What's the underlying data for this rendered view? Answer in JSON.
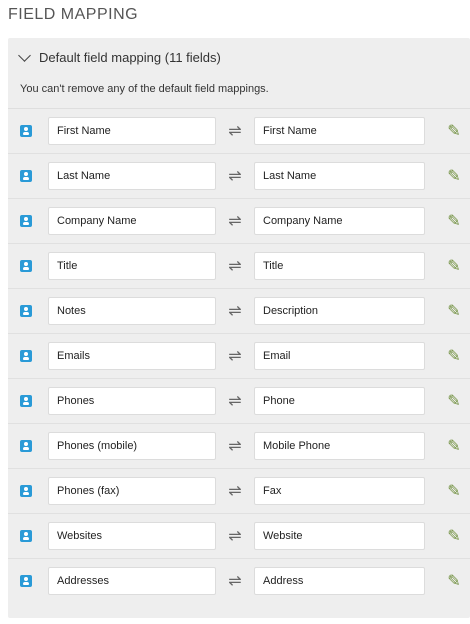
{
  "title": "FIELD MAPPING",
  "section": {
    "label": "Default field mapping (11 fields)",
    "note": "You can't remove any of the default field mappings."
  },
  "mappings": [
    {
      "left": "First Name",
      "right": "First Name"
    },
    {
      "left": "Last Name",
      "right": "Last Name"
    },
    {
      "left": "Company Name",
      "right": "Company Name"
    },
    {
      "left": "Title",
      "right": "Title"
    },
    {
      "left": "Notes",
      "right": "Description"
    },
    {
      "left": "Emails",
      "right": "Email"
    },
    {
      "left": "Phones",
      "right": "Phone"
    },
    {
      "left": "Phones (mobile)",
      "right": "Mobile Phone"
    },
    {
      "left": "Phones (fax)",
      "right": "Fax"
    },
    {
      "left": "Websites",
      "right": "Website"
    },
    {
      "left": "Addresses",
      "right": "Address"
    }
  ],
  "icons": {
    "contact": "contact-card-icon",
    "swap": "swap-arrows-icon",
    "action": "mapping-settings-icon"
  },
  "colors": {
    "panel": "#eeeeee",
    "accent": "#2a9ad7",
    "action": "#6f8f3d"
  }
}
